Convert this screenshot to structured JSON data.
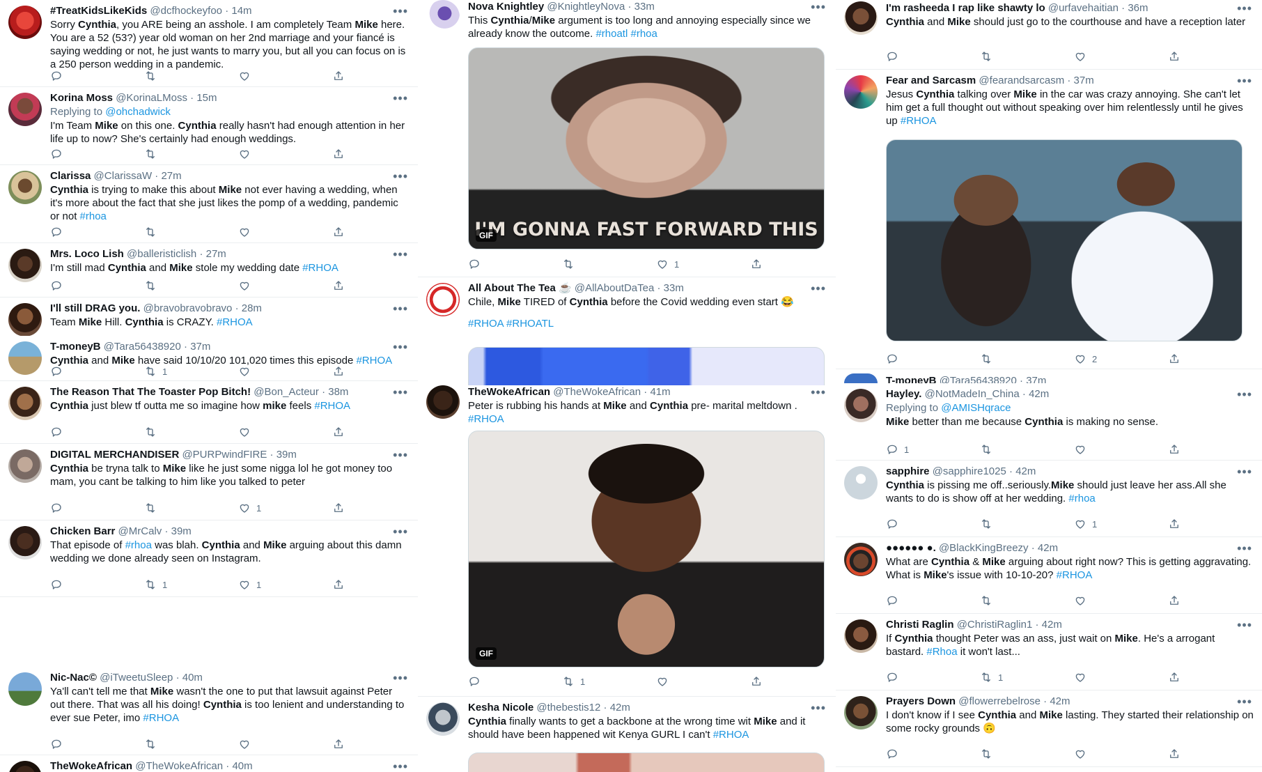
{
  "col1": [
    {
      "name": "#TreatKidsLikeKids",
      "handle": "@dcfhockeyfoo",
      "time": "14m",
      "text_html": "Sorry <b>Cynthia</b>, you ARE being an asshole. I am completely Team <b>Mike</b> here. You are a 52 (53?) year old woman on her 2nd marriage and your fiancé is saying wedding or not, he just wants to marry you, but all you can focus on is a 250 person wedding in a pandemic.",
      "reply_count": "",
      "retweet_count": "",
      "like_count": ""
    },
    {
      "name": "Korina Moss",
      "handle": "@KorinaLMoss",
      "time": "15m",
      "replying_label": "Replying to",
      "replying_handle": "@ohchadwick",
      "text_html": "I'm Team <b>Mike</b> on this one.  <b>Cynthia</b> really hasn't had enough attention in her life up to now? She's certainly had enough weddings.",
      "reply_count": "",
      "retweet_count": "",
      "like_count": ""
    },
    {
      "name": "Clarissa",
      "handle": "@ClarissaW",
      "time": "27m",
      "text_html": "<b>Cynthia</b> is trying to make this about <b>Mike</b> not ever having a wedding, when it's more about the fact that she just likes the pomp of a wedding, pandemic or not <span class=\"tag\">#rhoa</span>",
      "reply_count": "",
      "retweet_count": "",
      "like_count": ""
    },
    {
      "name": "Mrs. Loco Lish",
      "handle": "@balleristiclish",
      "time": "27m",
      "text_html": "I'm still mad <b>Cynthia</b> and <b>Mike</b> stole my wedding date <span class=\"tag\">#RHOA</span>",
      "reply_count": "",
      "retweet_count": "",
      "like_count": ""
    },
    {
      "name": "I'll still DRAG you.",
      "handle": "@bravobravobravo",
      "time": "28m",
      "text_html": "Team <b>Mike</b> Hill. <b>Cynthia</b> is CRAZY. <span class=\"tag\">#RHOA</span>",
      "reply_count": "",
      "retweet_count": "",
      "like_count": ""
    },
    {
      "name": "T-moneyB",
      "handle": "@Tara56438920",
      "time": "37m",
      "text_html": "<b>Cynthia</b> and <b>Mike</b> have said 10/10/20 101,020 times this episode <span class=\"tag\">#RHOA</span>",
      "reply_count": "",
      "retweet_count": "1",
      "like_count": ""
    },
    {
      "name": "The Reason That The Toaster Pop Bitch!",
      "handle": "@Bon_Acteur",
      "time": "38m",
      "text_html": "<b>Cynthia</b> just blew tf outta me so imagine how <b>mike</b> feels <span class=\"tag\">#RHOA</span>",
      "reply_count": "",
      "retweet_count": "",
      "like_count": ""
    },
    {
      "name": "DIGITAL MERCHANDISER",
      "handle": "@PURPwindFIRE",
      "time": "39m",
      "text_html": "<b>Cynthia</b> be tryna talk to <b>Mike</b> like he just some nigga lol he got money too mam, you cant be talking to him like you talked to peter",
      "reply_count": "",
      "retweet_count": "",
      "like_count": "1"
    },
    {
      "name": "Chicken Barr",
      "handle": "@MrCalv",
      "time": "39m",
      "text_html": "That episode of <span class=\"tag\">#rhoa</span> was blah. <b>Cynthia</b> and <b>Mike</b> arguing about this damn wedding we done already seen on Instagram.",
      "reply_count": "",
      "retweet_count": "1",
      "like_count": "1"
    },
    {
      "name": "Nic-Nac©",
      "handle": "@iTweetuSleep",
      "time": "40m",
      "text_html": "Ya'll can't tell me that <b>Mike</b> wasn't the one to put that lawsuit against Peter out there. That was all his doing! <b>Cynthia</b> is too lenient and understanding to ever sue Peter, imo <span class=\"tag\">#RHOA</span>",
      "reply_count": "",
      "retweet_count": "",
      "like_count": ""
    },
    {
      "name": "TheWokeAfrican",
      "handle": "@TheWokeAfrican",
      "time": "40m",
      "text_html": "",
      "reply_count": "",
      "retweet_count": "",
      "like_count": ""
    }
  ],
  "col2": [
    {
      "name": "Nova Knightley",
      "handle": "@KnightleyNova",
      "time": "33m",
      "text_html": "This <b>Cynthia</b>/<b>Mike</b> argument is too long and annoying especially since we already know the outcome. <span class=\"tag\">#rhoatl</span> <span class=\"tag\">#rhoa</span>",
      "gif_label": "GIF",
      "gif_caption": "I'M GONNA FAST FORWARD THIS",
      "reply_count": "",
      "retweet_count": "",
      "like_count": "1"
    },
    {
      "name": "All About The Tea ☕",
      "handle": "@AllAboutDaTea",
      "time": "33m",
      "text_html": "Chile, <b>Mike</b> TIRED of <b>Cynthia</b> before the Covid wedding even start 😂",
      "tags": "#RHOA #RHOATL",
      "reply_count": "",
      "retweet_count": "",
      "like_count": ""
    },
    {
      "name": "TheWokeAfrican",
      "handle": "@TheWokeAfrican",
      "time": "41m",
      "text_html": "Peter is rubbing his hands at <b>Mike</b> and <b>Cynthia</b> pre- marital meltdown . <span class=\"tag\">#RHOA</span>",
      "gif_label": "GIF",
      "reply_count": "",
      "retweet_count": "1",
      "like_count": ""
    },
    {
      "name": "Kesha Nicole",
      "handle": "@thebestis12",
      "time": "42m",
      "text_html": "<b>Cynthia</b> finally wants to get a backbone at the wrong time wit <b>Mike</b> and it should have been happened wit Kenya GURL I can't <span class=\"tag\">#RHOA</span>",
      "reply_count": "",
      "retweet_count": "",
      "like_count": ""
    }
  ],
  "col3": [
    {
      "name": "I'm rasheeda I rap like shawty lo",
      "handle": "@urfavehaitian",
      "time": "36m",
      "text_html": "<b>Cynthia</b> and <b>Mike</b> should just go to the courthouse and have a reception later",
      "reply_count": "",
      "retweet_count": "",
      "like_count": ""
    },
    {
      "name": "Fear and Sarcasm",
      "handle": "@fearandsarcasm",
      "time": "37m",
      "text_html": "Jesus <b>Cynthia</b> talking over <b>Mike</b> in the car was crazy annoying. She can't let him get a full thought out without speaking over him relentlessly until he gives up <span class=\"tag\">#RHOA</span>",
      "reply_count": "",
      "retweet_count": "",
      "like_count": "2"
    },
    {
      "name": "T-moneyB",
      "handle": "@Tara56438920",
      "time": "37m",
      "text_html": "",
      "reply_count": "",
      "retweet_count": "",
      "like_count": ""
    },
    {
      "name": "Hayley.",
      "handle": "@NotMadeIn_China",
      "time": "42m",
      "replying_label": "Replying to",
      "replying_handle": "@AMISHqrace",
      "text_html": "<b>Mike</b> better than me because <b>Cynthia</b> is making no sense.",
      "reply_count": "1",
      "retweet_count": "",
      "like_count": ""
    },
    {
      "name": "sapphire",
      "handle": "@sapphire1025",
      "time": "42m",
      "text_html": "<b>Cynthia</b> is pissing me off..seriously.<b>Mike</b> should just leave her ass.All she wants to do is show off at her wedding. <span class=\"tag\">#rhoa</span>",
      "reply_count": "",
      "retweet_count": "",
      "like_count": "1"
    },
    {
      "name": "●●●●●● ●.",
      "handle": "@BlackKingBreezy",
      "time": "42m",
      "text_html": "What are <b>Cynthia</b> &amp; <b>Mike</b> arguing about right now? This is getting aggravating. What is <b>Mike</b>'s issue with 10-10-20? <span class=\"tag\">#RHOA</span>",
      "reply_count": "",
      "retweet_count": "",
      "like_count": ""
    },
    {
      "name": "Christi Raglin",
      "handle": "@ChristiRaglin1",
      "time": "42m",
      "text_html": "If <b>Cynthia</b> thought Peter was an ass, just wait on <b>Mike</b>. He's a arrogant bastard. <span class=\"tag\">#Rhoa</span> it won't last...",
      "reply_count": "",
      "retweet_count": "1",
      "like_count": ""
    },
    {
      "name": "Prayers Down",
      "handle": "@flowerrebelrose",
      "time": "42m",
      "text_html": "I don't know if I see <b>Cynthia</b> and <b>Mike</b> lasting. They started their relationship on some rocky grounds 🙃",
      "reply_count": "",
      "retweet_count": "",
      "like_count": ""
    }
  ],
  "colors": {
    "accent": "#1b95e0",
    "text": "#0f1419",
    "secondary": "#5b7083",
    "border": "#ebeef0"
  },
  "icons": [
    "reply-icon",
    "retweet-icon",
    "like-icon",
    "share-icon",
    "more-icon"
  ]
}
